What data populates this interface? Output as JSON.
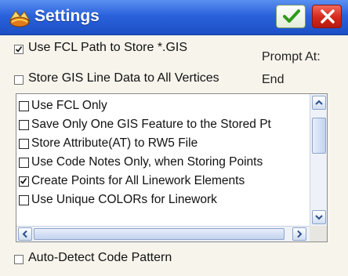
{
  "window": {
    "title": "Settings"
  },
  "options": {
    "use_fcl_path": {
      "label": "Use FCL Path to Store *.GIS",
      "checked": true
    },
    "store_gis_line": {
      "label": "Store GIS Line Data to All Vertices",
      "checked": false
    },
    "auto_detect": {
      "label": "Auto-Detect Code Pattern",
      "checked": false
    }
  },
  "prompt": {
    "label": "Prompt At:",
    "value": "End"
  },
  "list": {
    "items": [
      {
        "label": "Use FCL Only",
        "checked": false
      },
      {
        "label": "Save Only One GIS Feature to the Stored Pt",
        "checked": false
      },
      {
        "label": "Store Attribute(AT) to RW5 File",
        "checked": false
      },
      {
        "label": "Use Code Notes Only, when Storing Points",
        "checked": false
      },
      {
        "label": "Create Points for All Linework Elements",
        "checked": true
      },
      {
        "label": "Use Unique COLORs for Linework",
        "checked": false
      }
    ]
  },
  "icons": {
    "app": "gis-settings-icon",
    "ok": "checkmark-icon",
    "close": "close-icon"
  }
}
